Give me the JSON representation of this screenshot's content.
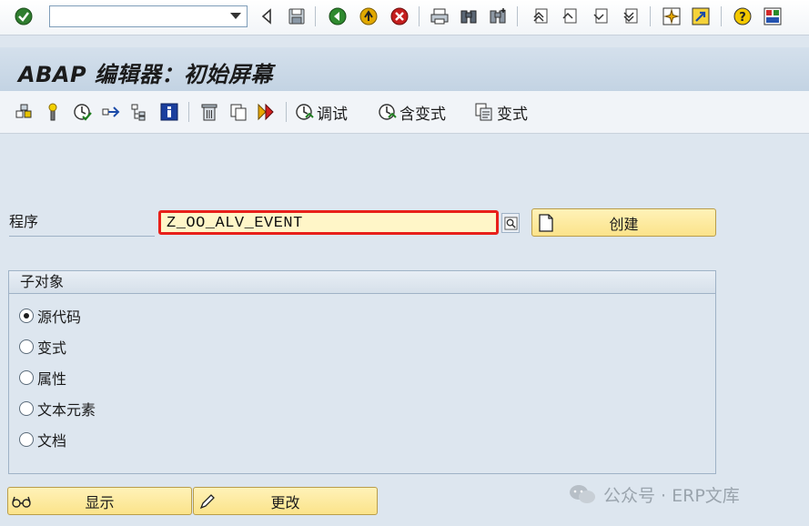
{
  "system_toolbar": {
    "command_field_value": "",
    "icons": [
      "enter-icon",
      "back-icon",
      "exit-icon",
      "cancel-icon",
      "save-icon",
      "print-icon",
      "find-icon",
      "find-next-icon",
      "first-page-icon",
      "previous-page-icon",
      "next-page-icon",
      "last-page-icon",
      "new-session-icon",
      "shortcut-icon",
      "help-icon",
      "layout-menu-icon"
    ]
  },
  "title": "ABAP 编辑器：初始屏幕",
  "app_toolbar": {
    "debug_label": "调试",
    "with_variant_label": "含变式",
    "variants_label": "变式"
  },
  "program": {
    "label": "程序",
    "value": "Z_OO_ALV_EVENT",
    "create_label": "创建"
  },
  "subobjects": {
    "header": "子对象",
    "options": [
      {
        "label": "源代码",
        "selected": true
      },
      {
        "label": "变式",
        "selected": false
      },
      {
        "label": "属性",
        "selected": false
      },
      {
        "label": "文本元素",
        "selected": false
      },
      {
        "label": "文档",
        "selected": false
      }
    ]
  },
  "buttons": {
    "display_label": "显示",
    "change_label": "更改"
  },
  "watermark": {
    "text": "公众号 · ERP文库"
  },
  "colors": {
    "highlight_border": "#e8201a",
    "input_bg": "#fff6c8",
    "button_bg": "#fbe38a",
    "screen_bg": "#dde6ef"
  }
}
